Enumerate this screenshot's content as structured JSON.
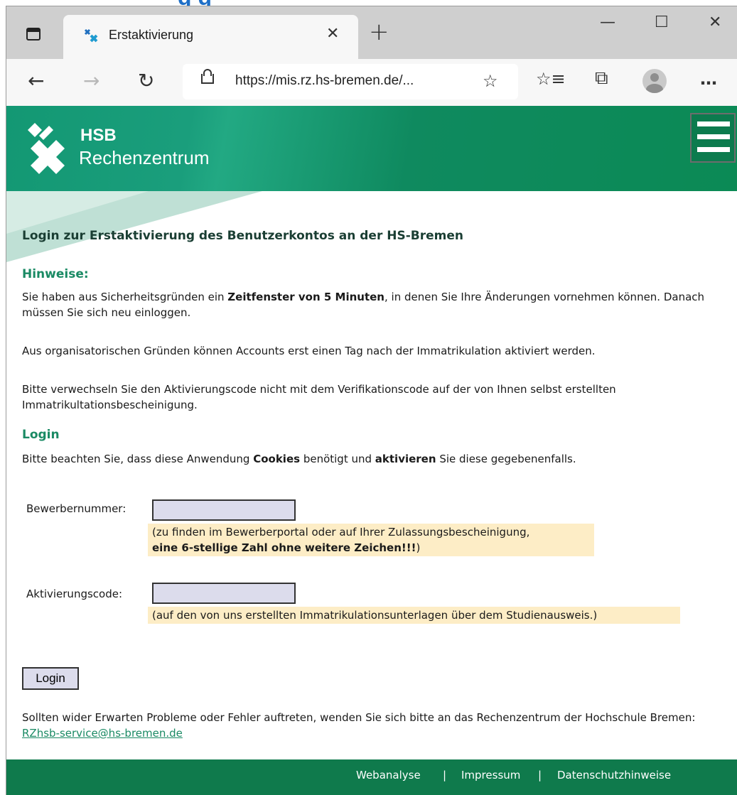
{
  "heading_cutoff": "g         g",
  "browser": {
    "tab_title": "Erstaktivierung",
    "url": "https://mis.rz.hs-bremen.de/...",
    "controls": {
      "minimize": "—",
      "maximize": "☐",
      "close": "✕"
    },
    "icons": [
      "tab-actions-icon",
      "favicon",
      "tab-close-icon",
      "new-tab-icon",
      "back-icon",
      "forward-icon",
      "refresh-icon",
      "lock-icon",
      "add-favorite-icon",
      "favorites-icon",
      "collections-icon",
      "profile-icon",
      "more-icon"
    ]
  },
  "header": {
    "brand_line1": "HSB",
    "brand_line2": "Rechenzentrum"
  },
  "page": {
    "title": "Login zur Erstaktivierung des Benutzerkontos an der HS-Bremen",
    "hinweise_heading": "Hinweise:",
    "p1_a": "Sie haben aus Sicherheitsgründen ein ",
    "p1_bold": "Zeitfenster von 5 Minuten",
    "p1_b": ", in denen Sie Ihre Änderungen vornehmen können. Danach müssen Sie sich neu einloggen.",
    "p2": "Aus organisatorischen Gründen können Accounts erst einen Tag nach der Immatrikulation aktiviert werden.",
    "p3": "Bitte verwechseln Sie den Aktivierungscode nicht mit dem Verifikationscode auf der von Ihnen selbst erstellten Immatrikultationsbescheinigung.",
    "login_heading": "Login",
    "p4_a": "Bitte beachten Sie, dass diese Anwendung ",
    "p4_bold1": "Cookies",
    "p4_b": " benötigt und ",
    "p4_bold2": "aktivieren",
    "p4_c": " Sie diese gegebenenfalls."
  },
  "form": {
    "bewerber_label": "Bewerbernummer:",
    "bewerber_value": "",
    "bewerber_hint_line1": "(zu finden im Bewerberportal oder auf Ihrer Zulassungsbescheinigung,",
    "bewerber_hint_bold": "eine 6-stellige Zahl ohne weitere Zeichen!!!",
    "bewerber_hint_end": ")",
    "aktiv_label": "Aktivierungscode:",
    "aktiv_value": "",
    "aktiv_hint": "(auf den von uns erstellten Immatrikulationsunterlagen über dem Studienausweis.)",
    "login_button": "Login"
  },
  "contact": {
    "text": "Sollten wider Erwarten Probleme oder Fehler auftreten, wenden Sie sich bitte an das Rechenzentrum der Hochschule Bremen: ",
    "email": "RZhsb-service@hs-bremen.de"
  },
  "footer": {
    "links": [
      "Webanalyse",
      "Impressum",
      "Datenschutzhinweise"
    ],
    "separator": "|"
  },
  "colors": {
    "brand_green": "#0f8a5f",
    "section_green": "#1a8a64",
    "hint_background": "#fdedc6",
    "input_background": "#dcdcec"
  }
}
